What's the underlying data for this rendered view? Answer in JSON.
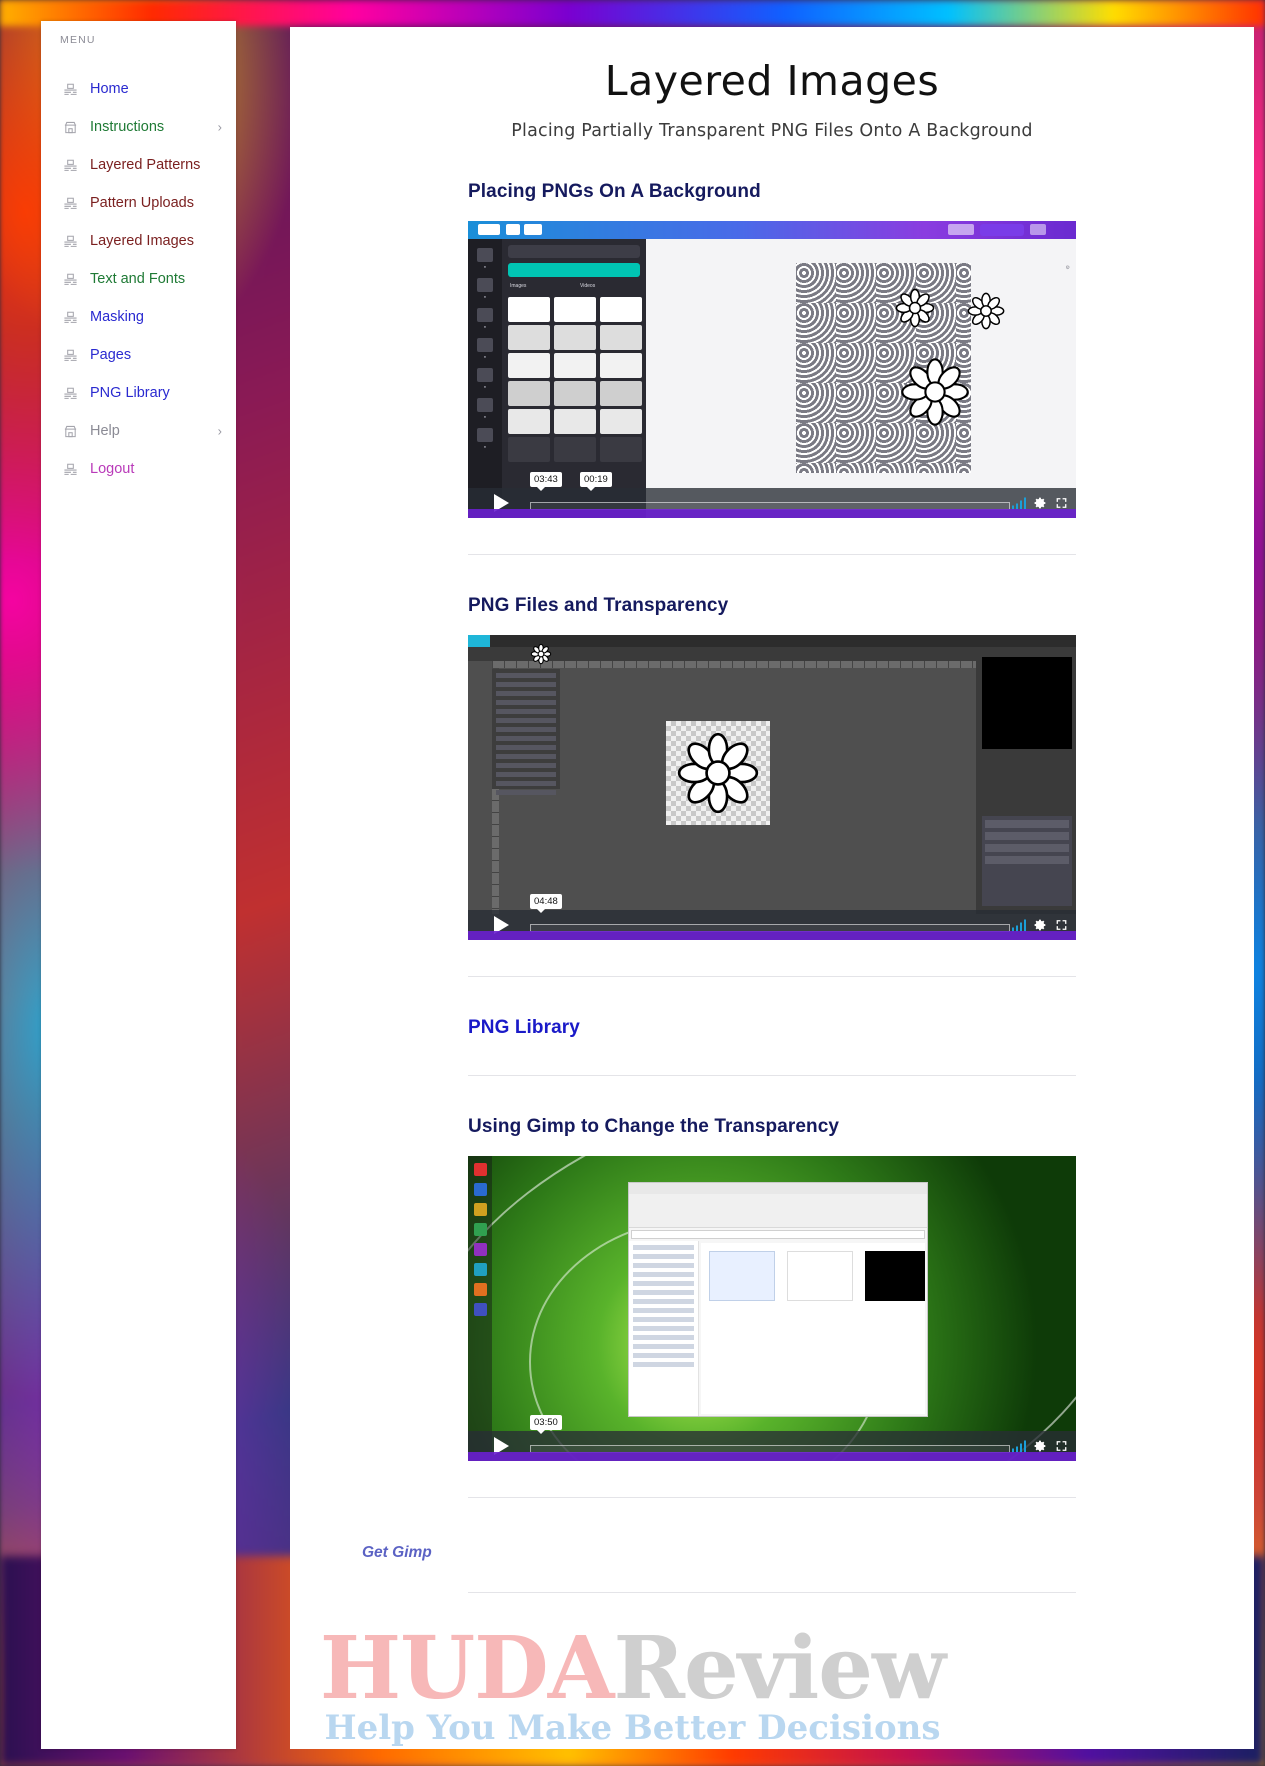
{
  "sidebar": {
    "menu_label": "MENU",
    "items": [
      {
        "label": "Home",
        "icon": "presentation-icon",
        "color": "#2a2ad0",
        "chevron": false
      },
      {
        "label": "Instructions",
        "icon": "store-icon",
        "color": "#1f7a35",
        "chevron": true
      },
      {
        "label": "Layered Patterns",
        "icon": "presentation-icon",
        "color": "#7a1f1f",
        "chevron": false
      },
      {
        "label": "Pattern Uploads",
        "icon": "presentation-icon",
        "color": "#7a1f1f",
        "chevron": false
      },
      {
        "label": "Layered Images",
        "icon": "presentation-icon",
        "color": "#7a1f1f",
        "chevron": false
      },
      {
        "label": "Text and Fonts",
        "icon": "presentation-icon",
        "color": "#1f7a35",
        "chevron": false
      },
      {
        "label": "Masking",
        "icon": "presentation-icon",
        "color": "#2a2ad0",
        "chevron": false
      },
      {
        "label": "Pages",
        "icon": "presentation-icon",
        "color": "#2a2ad0",
        "chevron": false
      },
      {
        "label": "PNG Library",
        "icon": "presentation-icon",
        "color": "#2a2ad0",
        "chevron": false
      },
      {
        "label": "Help",
        "icon": "store-icon",
        "color": "#8b8b95",
        "chevron": true
      },
      {
        "label": "Logout",
        "icon": "presentation-icon",
        "color": "#b93ab9",
        "chevron": false
      }
    ]
  },
  "main": {
    "title": "Layered Images",
    "subtitle": "Placing Partially Transparent PNG Files Onto A Background",
    "sections": [
      {
        "heading": "Placing PNGs On A Background",
        "style": "navy",
        "video": {
          "present": true,
          "kind": "canva-editor",
          "time_left": "03:43",
          "time_right": "00:19"
        }
      },
      {
        "heading": "PNG Files and Transparency",
        "style": "navy",
        "video": {
          "present": true,
          "kind": "gimp",
          "time_left": "04:48",
          "time_right": ""
        }
      },
      {
        "heading": "PNG Library",
        "style": "blue",
        "video": {
          "present": false,
          "kind": "",
          "time_left": "",
          "time_right": ""
        }
      },
      {
        "heading": "Using Gimp to Change the Transparency",
        "style": "navy",
        "video": {
          "present": true,
          "kind": "windows-desktop",
          "time_left": "03:50",
          "time_right": ""
        }
      }
    ],
    "get_gimp_link": "Get Gimp"
  },
  "watermark": {
    "brand_first": "HUDA",
    "brand_second": "Review",
    "tagline": "Help You Make Better Decisions"
  }
}
